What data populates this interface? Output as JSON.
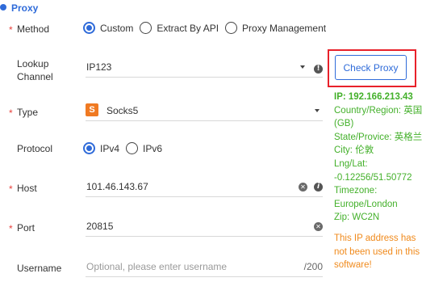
{
  "section": {
    "title": "Proxy"
  },
  "required_mark": "*",
  "method": {
    "label": "Method",
    "options": [
      {
        "label": "Custom",
        "checked": true
      },
      {
        "label": "Extract By API",
        "checked": false
      },
      {
        "label": "Proxy Management",
        "checked": false
      }
    ]
  },
  "lookup": {
    "label_line1": "Lookup",
    "label_line2": "Channel",
    "value": "IP123",
    "info_glyph": "!",
    "check_button": "Check Proxy"
  },
  "type": {
    "label": "Type",
    "badge": "S",
    "value": "Socks5"
  },
  "protocol": {
    "label": "Protocol",
    "options": [
      {
        "label": "IPv4",
        "checked": true
      },
      {
        "label": "IPv6",
        "checked": false
      }
    ]
  },
  "host": {
    "label": "Host",
    "value": "101.46.143.67",
    "clear_glyph": "✕",
    "info_glyph": "i"
  },
  "port": {
    "label": "Port",
    "value": "20815",
    "clear_glyph": "✕"
  },
  "username": {
    "label": "Username",
    "placeholder": "Optional, please enter username",
    "counter": "/200"
  },
  "result": {
    "ip": "IP:  192.166.213.43",
    "lines": [
      "Country/Region: 英国",
      "(GB)",
      "State/Provice: 英格兰",
      "City: 伦敦",
      "Lng/Lat:",
      "-0.12256/51.50772",
      "Timezone:",
      "Europe/London",
      "Zip: WC2N"
    ]
  },
  "warning": {
    "lines": [
      "This IP address has",
      "not been used in this",
      "software!"
    ]
  },
  "colors": {
    "accent": "#2f6bd9",
    "required": "#e8413c",
    "success": "#43b02a",
    "warning": "#f08a1c",
    "highlight_frame": "#e8212a",
    "badge": "#f07a22"
  }
}
